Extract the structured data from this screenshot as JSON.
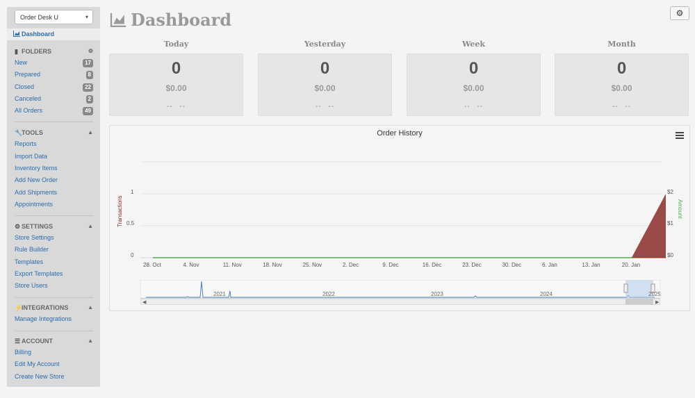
{
  "sidebar": {
    "store_select": "Order Desk U",
    "dashboard_label": "Dashboard",
    "folders": {
      "heading": "FOLDERS",
      "items": [
        {
          "label": "New",
          "count": "17"
        },
        {
          "label": "Prepared",
          "count": "8"
        },
        {
          "label": "Closed",
          "count": "22"
        },
        {
          "label": "Canceled",
          "count": "2"
        },
        {
          "label": "All Orders",
          "count": "49"
        }
      ]
    },
    "tools": {
      "heading": "TOOLS",
      "items": [
        "Reports",
        "Import Data",
        "Inventory Items",
        "Add New Order",
        "Add Shipments",
        "Appointments"
      ]
    },
    "settings": {
      "heading": "SETTINGS",
      "items": [
        "Store Settings",
        "Rule Builder",
        "Templates",
        "Export Templates",
        "Store Users"
      ]
    },
    "integrations": {
      "heading": "INTEGRATIONS",
      "items": [
        "Manage Integrations"
      ]
    },
    "account": {
      "heading": "ACCOUNT",
      "items": [
        "Billing",
        "Edit My Account",
        "Create New Store"
      ]
    }
  },
  "page_title": "Dashboard",
  "stats": [
    {
      "label": "Today",
      "count": "0",
      "amount": "$0.00",
      "compare": "-- --"
    },
    {
      "label": "Yesterday",
      "count": "0",
      "amount": "$0.00",
      "compare": "-- --"
    },
    {
      "label": "Week",
      "count": "0",
      "amount": "$0.00",
      "compare": "-- --"
    },
    {
      "label": "Month",
      "count": "0",
      "amount": "$0.00",
      "compare": "-- --"
    }
  ],
  "chart": {
    "title": "Order History",
    "left_axis_label": "Transactions",
    "right_axis_label": "Amount",
    "left_ticks": [
      "1",
      "0.5",
      "0"
    ],
    "right_ticks": [
      "$2",
      "$1",
      "$0"
    ],
    "x_ticks": [
      "28. Oct",
      "4. Nov",
      "11. Nov",
      "18. Nov",
      "25. Nov",
      "2. Dec",
      "9. Dec",
      "16. Dec",
      "23. Dec",
      "30. Dec",
      "6. Jan",
      "13. Jan",
      "20. Jan"
    ],
    "navigator_years": [
      "2021",
      "2022",
      "2023",
      "2024",
      "2025"
    ],
    "colors": {
      "transactions": "#8b2b2b",
      "amount": "#4caf50",
      "navigator": "#4a7fc0"
    }
  },
  "chart_data": {
    "type": "area",
    "title": "Order History",
    "ylabel": "Transactions",
    "y2label": "Amount",
    "ylim": [
      0,
      1
    ],
    "y2lim": [
      0,
      2
    ],
    "series": [
      {
        "name": "Transactions",
        "points": [
          {
            "x": "28. Oct",
            "y": 0
          },
          {
            "x": "20. Jan",
            "y": 0
          },
          {
            "x": "26. Jan",
            "y": 1
          }
        ]
      },
      {
        "name": "Amount",
        "points": [
          {
            "x": "28. Oct",
            "y": 0
          },
          {
            "x": "26. Jan",
            "y": 0
          }
        ]
      }
    ]
  }
}
